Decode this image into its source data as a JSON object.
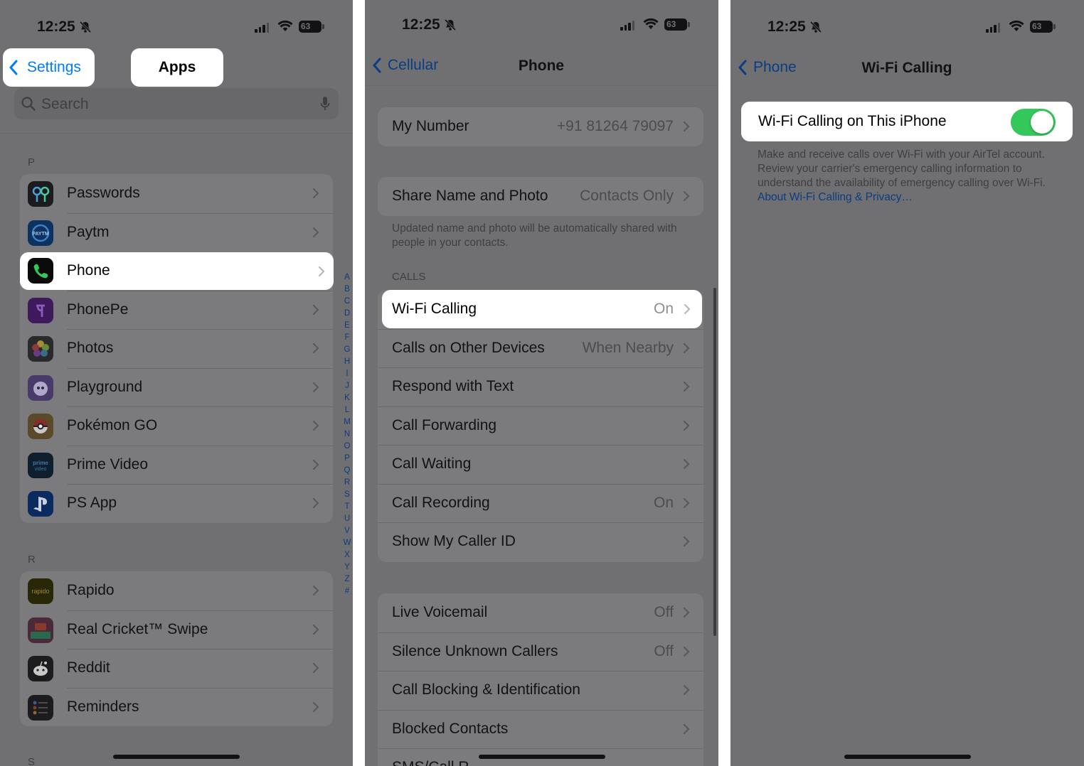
{
  "status_bar": {
    "time": "12:25",
    "battery": "63"
  },
  "colors": {
    "link_blue": "#007aff",
    "toggle_on": "#34c759",
    "dim_overlay": "#707072"
  },
  "screen1": {
    "back_label": "Settings",
    "title": "Apps",
    "search_placeholder": "Search",
    "section_p": "P",
    "section_r": "R",
    "section_s": "S",
    "apps_p": [
      {
        "label": "Passwords",
        "icon": "passwords-icon"
      },
      {
        "label": "Paytm",
        "icon": "paytm-icon"
      },
      {
        "label": "Phone",
        "icon": "phone-icon"
      },
      {
        "label": "PhonePe",
        "icon": "phonepe-icon"
      },
      {
        "label": "Photos",
        "icon": "photos-icon"
      },
      {
        "label": "Playground",
        "icon": "playground-icon"
      },
      {
        "label": "Pokémon GO",
        "icon": "pokemon-go-icon"
      },
      {
        "label": "Prime Video",
        "icon": "prime-video-icon"
      },
      {
        "label": "PS App",
        "icon": "ps-app-icon"
      }
    ],
    "apps_r": [
      {
        "label": "Rapido",
        "icon": "rapido-icon"
      },
      {
        "label": "Real Cricket™ Swipe",
        "icon": "real-cricket-icon"
      },
      {
        "label": "Reddit",
        "icon": "reddit-icon"
      },
      {
        "label": "Reminders",
        "icon": "reminders-icon"
      }
    ],
    "index_letters": [
      "A",
      "B",
      "C",
      "D",
      "E",
      "F",
      "G",
      "H",
      "I",
      "J",
      "K",
      "L",
      "M",
      "N",
      "O",
      "P",
      "Q",
      "R",
      "S",
      "T",
      "U",
      "V",
      "W",
      "X",
      "Y",
      "Z",
      "#"
    ]
  },
  "screen2": {
    "back_label": "Cellular",
    "title": "Phone",
    "my_number": {
      "label": "My Number",
      "value": "+91 81264 79097"
    },
    "share": {
      "label": "Share Name and Photo",
      "value": "Contacts Only"
    },
    "share_note": "Updated name and photo will be automatically shared with people in your contacts.",
    "calls_header": "CALLS",
    "calls": [
      {
        "label": "Wi-Fi Calling",
        "value": "On"
      },
      {
        "label": "Calls on Other Devices",
        "value": "When Nearby"
      },
      {
        "label": "Respond with Text",
        "value": ""
      },
      {
        "label": "Call Forwarding",
        "value": ""
      },
      {
        "label": "Call Waiting",
        "value": ""
      },
      {
        "label": "Call Recording",
        "value": "On"
      },
      {
        "label": "Show My Caller ID",
        "value": ""
      }
    ],
    "more": [
      {
        "label": "Live Voicemail",
        "value": "Off"
      },
      {
        "label": "Silence Unknown Callers",
        "value": "Off"
      },
      {
        "label": "Call Blocking & Identification",
        "value": ""
      },
      {
        "label": "Blocked Contacts",
        "value": ""
      },
      {
        "label": "SMS/Call R…",
        "value": ""
      }
    ]
  },
  "screen3": {
    "back_label": "Phone",
    "title": "Wi-Fi Calling",
    "toggle_label": "Wi-Fi Calling on This iPhone",
    "toggle_on": true,
    "note": "Make and receive calls over Wi-Fi with your AirTel account. Review your carrier's emergency calling information to understand the availability of emergency calling over Wi-Fi.",
    "note_link": "About Wi-Fi Calling & Privacy…"
  }
}
